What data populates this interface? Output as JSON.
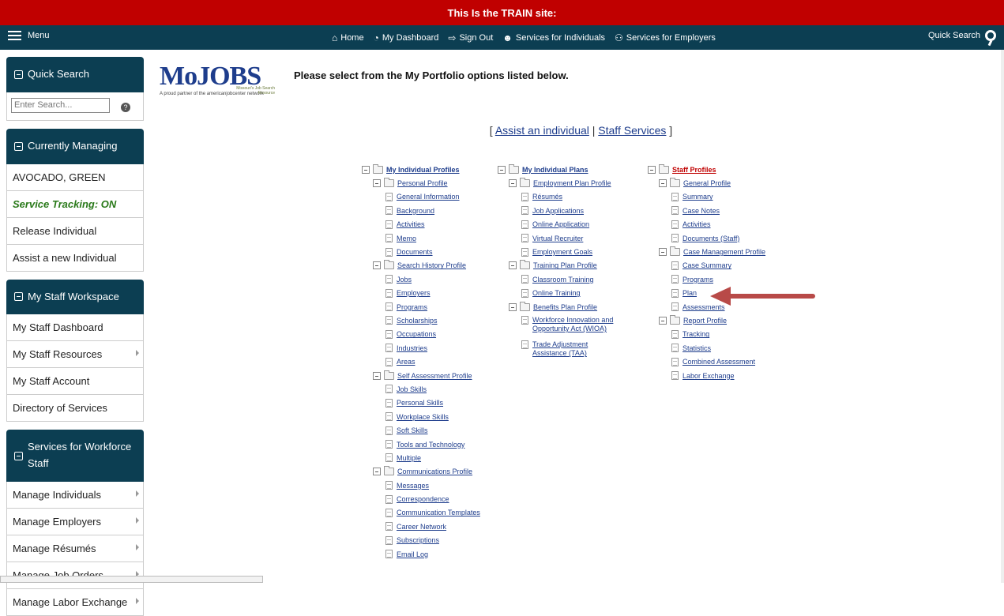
{
  "banner": "This Is the TRAIN site:",
  "nav": {
    "menu": "Menu",
    "links": [
      {
        "icon": "home-icon",
        "glyph": "⌂",
        "label": "Home"
      },
      {
        "icon": "dashboard-icon",
        "glyph": "◔",
        "label": "My Dashboard"
      },
      {
        "icon": "sign-out-icon",
        "glyph": "⇨",
        "label": "Sign Out"
      },
      {
        "icon": "user-icon",
        "glyph": "☻",
        "label": "Services for Individuals"
      },
      {
        "icon": "group-icon",
        "glyph": "⚇",
        "label": "Services for Employers"
      }
    ],
    "quick_search": "Quick Search"
  },
  "sidebar": {
    "quick_search": {
      "title": "Quick Search",
      "placeholder": "Enter Search...",
      "help": "?"
    },
    "currently_managing": {
      "title": "Currently Managing",
      "items": [
        "AVOCADO, GREEN",
        "Service Tracking: ON",
        "Release Individual",
        "Assist a new Individual"
      ]
    },
    "staff_workspace": {
      "title": "My Staff Workspace",
      "items": [
        "My Staff Dashboard",
        "My Staff Resources",
        "My Staff Account",
        "Directory of Services"
      ]
    },
    "workforce": {
      "title": "Services for Workforce Staff",
      "items": [
        "Manage Individuals",
        "Manage Employers",
        "Manage Résumés",
        "Manage Job Orders",
        "Manage Labor Exchange"
      ]
    }
  },
  "logo": {
    "main": "MoJOBS",
    "tag": "Missouri's Job Search Resource",
    "sub": "A proud partner of the americanjobcenter network"
  },
  "heading": "Please select from the My Portfolio options listed below.",
  "assist": {
    "open": "[ ",
    "link1": "Assist an individual",
    "sep": " | ",
    "link2": "Staff Services",
    "close": " ]"
  },
  "tree": {
    "col1": [
      {
        "lvl": 0,
        "type": "folder",
        "label": "My Individual Profiles",
        "top": true
      },
      {
        "lvl": 1,
        "type": "folder",
        "label": "Personal Profile"
      },
      {
        "lvl": 2,
        "type": "doc",
        "label": "General Information"
      },
      {
        "lvl": 2,
        "type": "doc",
        "label": "Background"
      },
      {
        "lvl": 2,
        "type": "doc",
        "label": "Activities"
      },
      {
        "lvl": 2,
        "type": "doc",
        "label": "Memo"
      },
      {
        "lvl": 2,
        "type": "doc",
        "label": "Documents"
      },
      {
        "lvl": 1,
        "type": "folder",
        "label": "Search History Profile"
      },
      {
        "lvl": 2,
        "type": "doc",
        "label": "Jobs"
      },
      {
        "lvl": 2,
        "type": "doc",
        "label": "Employers"
      },
      {
        "lvl": 2,
        "type": "doc",
        "label": "Programs"
      },
      {
        "lvl": 2,
        "type": "doc",
        "label": "Scholarships"
      },
      {
        "lvl": 2,
        "type": "doc",
        "label": "Occupations"
      },
      {
        "lvl": 2,
        "type": "doc",
        "label": "Industries"
      },
      {
        "lvl": 2,
        "type": "doc",
        "label": "Areas"
      },
      {
        "lvl": 1,
        "type": "folder",
        "label": "Self Assessment Profile"
      },
      {
        "lvl": 2,
        "type": "doc",
        "label": "Job Skills"
      },
      {
        "lvl": 2,
        "type": "doc",
        "label": "Personal Skills"
      },
      {
        "lvl": 2,
        "type": "doc",
        "label": "Workplace Skills"
      },
      {
        "lvl": 2,
        "type": "doc",
        "label": "Soft Skills"
      },
      {
        "lvl": 2,
        "type": "doc",
        "label": "Tools and Technology"
      },
      {
        "lvl": 2,
        "type": "doc",
        "label": "Multiple"
      },
      {
        "lvl": 1,
        "type": "folder",
        "label": "Communications Profile"
      },
      {
        "lvl": 2,
        "type": "doc",
        "label": "Messages"
      },
      {
        "lvl": 2,
        "type": "doc",
        "label": "Correspondence"
      },
      {
        "lvl": 2,
        "type": "doc",
        "label": "Communication Templates"
      },
      {
        "lvl": 2,
        "type": "doc",
        "label": "Career Network"
      },
      {
        "lvl": 2,
        "type": "doc",
        "label": "Subscriptions"
      },
      {
        "lvl": 2,
        "type": "doc",
        "label": "Email Log"
      }
    ],
    "col2": [
      {
        "lvl": 0,
        "type": "folder",
        "label": "My Individual Plans",
        "top": true
      },
      {
        "lvl": 1,
        "type": "folder",
        "label": "Employment Plan Profile"
      },
      {
        "lvl": 2,
        "type": "doc",
        "label": "Résumés"
      },
      {
        "lvl": 2,
        "type": "doc",
        "label": "Job Applications"
      },
      {
        "lvl": 2,
        "type": "doc",
        "label": "Online Application"
      },
      {
        "lvl": 2,
        "type": "doc",
        "label": "Virtual Recruiter"
      },
      {
        "lvl": 2,
        "type": "doc",
        "label": "Employment Goals"
      },
      {
        "lvl": 1,
        "type": "folder",
        "label": "Training Plan Profile"
      },
      {
        "lvl": 2,
        "type": "doc",
        "label": "Classroom Training"
      },
      {
        "lvl": 2,
        "type": "doc",
        "label": "Online Training"
      },
      {
        "lvl": 1,
        "type": "folder",
        "label": "Benefits Plan Profile"
      },
      {
        "lvl": 2,
        "type": "doc",
        "label": "Workforce Innovation and\nOpportunity Act (WIOA)",
        "multi": true
      },
      {
        "lvl": 2,
        "type": "doc",
        "label": "Trade Adjustment\nAssistance (TAA)",
        "multi": true
      }
    ],
    "col3": [
      {
        "lvl": 0,
        "type": "folder",
        "label": "Staff Profiles",
        "top": true,
        "red": true
      },
      {
        "lvl": 1,
        "type": "folder",
        "label": "General Profile"
      },
      {
        "lvl": 2,
        "type": "doc",
        "label": "Summary"
      },
      {
        "lvl": 2,
        "type": "doc",
        "label": "Case Notes"
      },
      {
        "lvl": 2,
        "type": "doc",
        "label": "Activities"
      },
      {
        "lvl": 2,
        "type": "doc",
        "label": "Documents (Staff)"
      },
      {
        "lvl": 1,
        "type": "folder",
        "label": "Case Management Profile"
      },
      {
        "lvl": 2,
        "type": "doc",
        "label": "Case Summary"
      },
      {
        "lvl": 2,
        "type": "doc",
        "label": "Programs"
      },
      {
        "lvl": 2,
        "type": "doc",
        "label": "Plan"
      },
      {
        "lvl": 2,
        "type": "doc",
        "label": "Assessments"
      },
      {
        "lvl": 1,
        "type": "folder",
        "label": "Report Profile"
      },
      {
        "lvl": 2,
        "type": "doc",
        "label": "Tracking"
      },
      {
        "lvl": 2,
        "type": "doc",
        "label": "Statistics"
      },
      {
        "lvl": 2,
        "type": "doc",
        "label": "Combined Assessment"
      },
      {
        "lvl": 2,
        "type": "doc",
        "label": "Labor Exchange"
      }
    ]
  },
  "annotation": {
    "arrow_color": "#b84a48",
    "points_to": "Plan"
  },
  "colors": {
    "banner": "#c00000",
    "nav": "#0c3e52",
    "link": "#1e3d8c",
    "tracking": "#2a7a1a"
  }
}
